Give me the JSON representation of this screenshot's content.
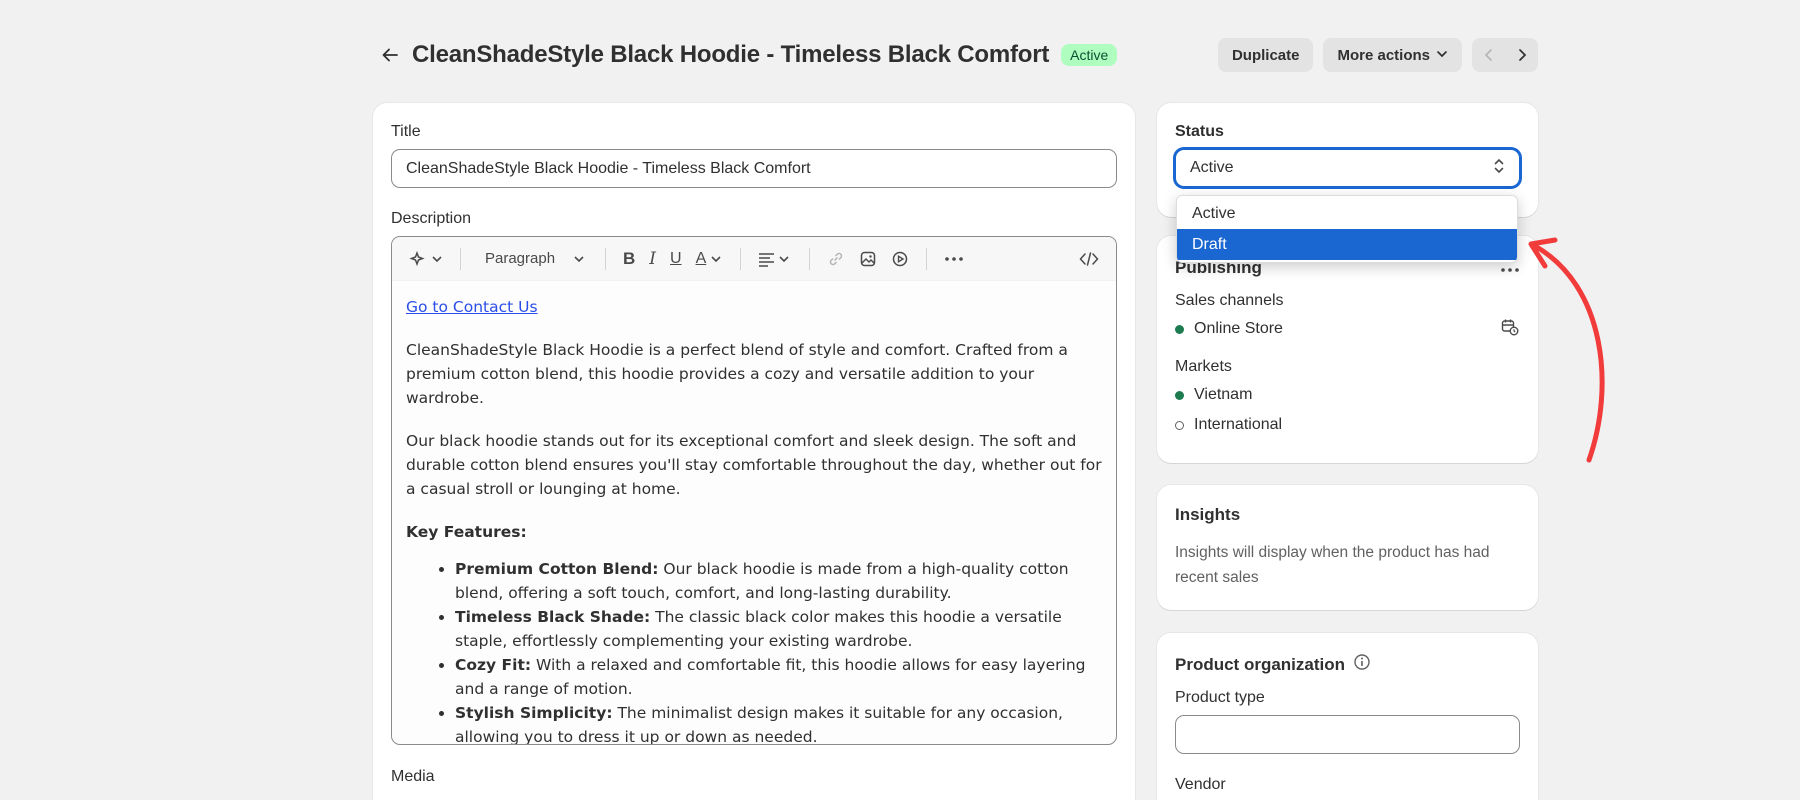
{
  "header": {
    "title": "CleanShadeStyle Black Hoodie - Timeless Black Comfort",
    "status_badge": "Active",
    "duplicate_label": "Duplicate",
    "more_actions_label": "More actions"
  },
  "main": {
    "title_label": "Title",
    "title_value": "CleanShadeStyle Black Hoodie - Timeless Black Comfort",
    "description_label": "Description",
    "toolbar": {
      "paragraph_label": "Paragraph"
    },
    "description": {
      "link": "Go to Contact Us",
      "para1": "CleanShadeStyle Black Hoodie is a perfect blend of style and comfort. Crafted from a premium cotton blend, this hoodie provides a cozy and versatile addition to your wardrobe.",
      "para2": "Our black hoodie stands out for its exceptional comfort and sleek design. The soft and durable cotton blend ensures you'll stay comfortable throughout the day, whether out for a casual stroll or lounging at home.",
      "key_features": "Key Features:",
      "features": [
        {
          "title": "Premium Cotton Blend:",
          "text": " Our black hoodie is made from a high-quality cotton blend, offering a soft touch, comfort, and long-lasting durability."
        },
        {
          "title": "Timeless Black Shade:",
          "text": " The classic black color makes this hoodie a versatile staple, effortlessly complementing your existing wardrobe."
        },
        {
          "title": "Cozy Fit:",
          "text": " With a relaxed and comfortable fit, this hoodie allows for easy layering and a range of motion."
        },
        {
          "title": "Stylish Simplicity:",
          "text": " The minimalist design makes it suitable for any occasion, allowing you to dress it up or down as needed."
        }
      ]
    },
    "media_label": "Media"
  },
  "status": {
    "label": "Status",
    "selected": "Active",
    "options": [
      "Active",
      "Draft"
    ],
    "highlighted": "Draft"
  },
  "publishing": {
    "title": "Publishing",
    "sales_channels_label": "Sales channels",
    "channels": [
      "Online Store"
    ],
    "markets_label": "Markets",
    "markets": [
      "Vietnam",
      "International"
    ]
  },
  "insights": {
    "title": "Insights",
    "text": "Insights will display when the product has had recent sales"
  },
  "organization": {
    "title": "Product organization",
    "product_type_label": "Product type",
    "vendor_label": "Vendor"
  },
  "colors": {
    "accent": "#1a67d2",
    "badge_bg": "#affebf",
    "active_dot": "#1c7b4f",
    "annotation_arrow": "#f23b3b"
  }
}
